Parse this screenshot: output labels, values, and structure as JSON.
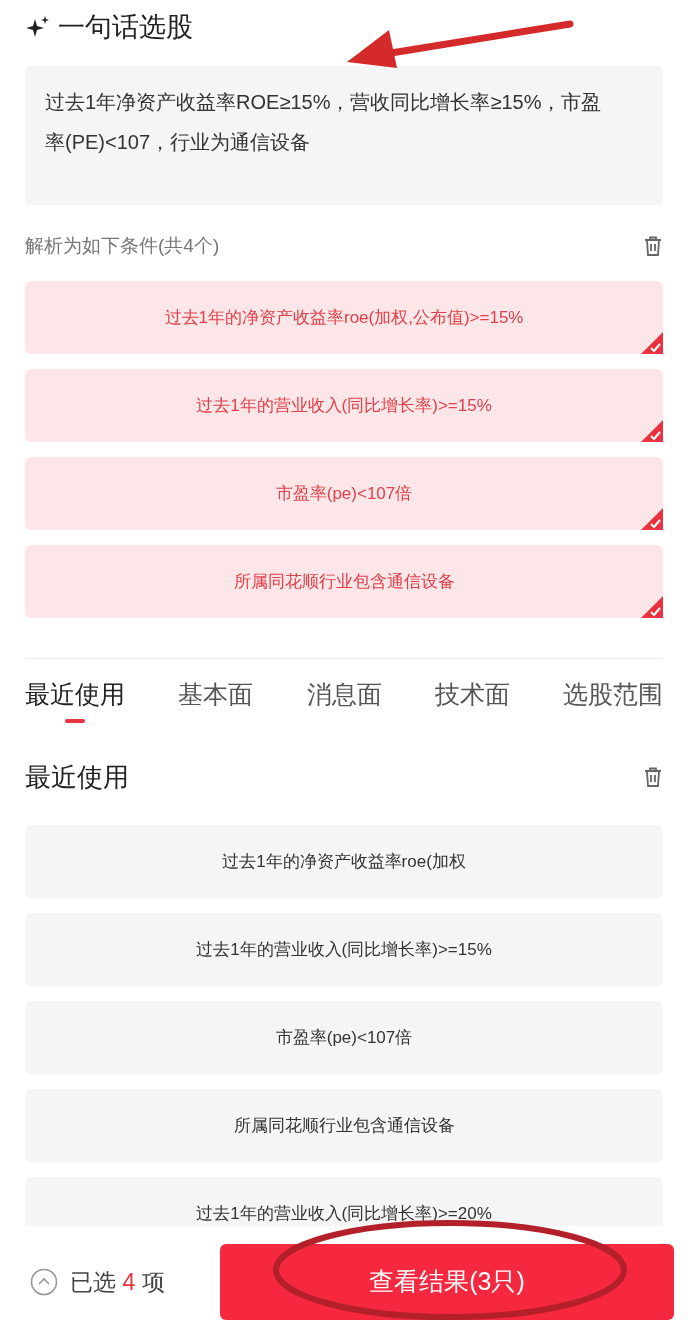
{
  "header": {
    "title": "一句话选股"
  },
  "query": {
    "value": "过去1年净资产收益率ROE≥15%，营收同比增长率≥15%，市盈率(PE)<107，行业为通信设备"
  },
  "parsed": {
    "label": "解析为如下条件(共4个)"
  },
  "conditions": [
    {
      "text": "过去1年的净资产收益率roe(加权,公布值)>=15%",
      "checked": true
    },
    {
      "text": "过去1年的营业收入(同比增长率)>=15%",
      "checked": true
    },
    {
      "text": "市盈率(pe)<107倍",
      "checked": true
    },
    {
      "text": "所属同花顺行业包含通信设备",
      "checked": true
    }
  ],
  "tabs": [
    {
      "label": "最近使用",
      "selected": true
    },
    {
      "label": "基本面",
      "selected": false
    },
    {
      "label": "消息面",
      "selected": false
    },
    {
      "label": "技术面",
      "selected": false
    },
    {
      "label": "选股范围",
      "selected": false
    }
  ],
  "recent": {
    "title": "最近使用",
    "items": [
      {
        "text": "过去1年的净资产收益率roe(加权"
      },
      {
        "text": "过去1年的营业收入(同比增长率)>=15%"
      },
      {
        "text": "市盈率(pe)<107倍"
      },
      {
        "text": "所属同花顺行业包含通信设备"
      },
      {
        "text": "过去1年的营业收入(同比增长率)>=20%"
      }
    ]
  },
  "footer": {
    "selected_prefix": "已选",
    "selected_count": "4",
    "selected_suffix": "项",
    "result_button": "查看结果(3只)"
  },
  "annotations": [
    {
      "kind": "arrow"
    },
    {
      "kind": "ellipse"
    }
  ]
}
